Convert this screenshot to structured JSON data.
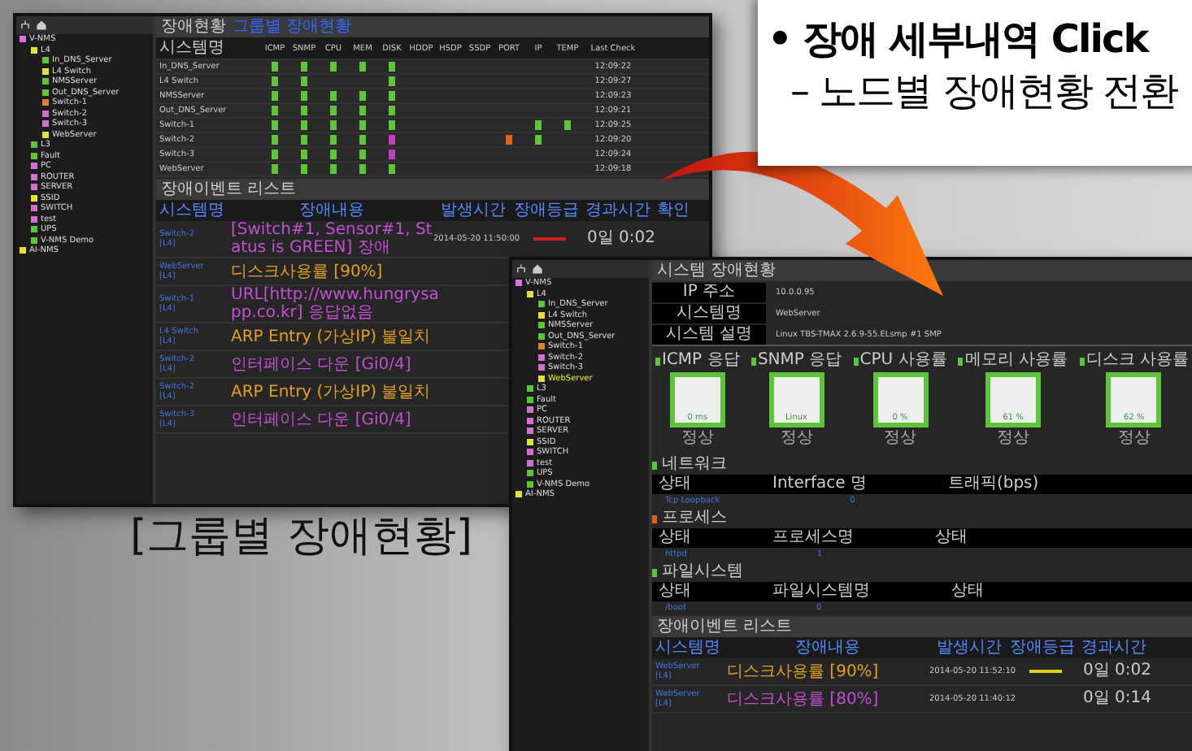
{
  "caption": {
    "title": "• 장애 세부내역 Click",
    "subtitle": "– 노드별 장애현황 전환"
  },
  "group_caption": "[그룹별 장애현황]",
  "group_window": {
    "tree": [
      {
        "label": "V-NMS",
        "color": "#e070e0",
        "selected": false,
        "children": [
          {
            "label": "L4",
            "color": "#e0e040",
            "selected": false,
            "children": [
              {
                "label": "In_DNS_Server",
                "color": "#5ec43a",
                "selected": false
              },
              {
                "label": "L4 Switch",
                "color": "#e0e040",
                "selected": false
              },
              {
                "label": "NMSServer",
                "color": "#5ec43a",
                "selected": false
              },
              {
                "label": "Out_DNS_Server",
                "color": "#5ec43a",
                "selected": false
              },
              {
                "label": "Switch-1",
                "color": "#e08030",
                "selected": false
              },
              {
                "label": "Switch-2",
                "color": "#d070d0",
                "selected": false
              },
              {
                "label": "Switch-3",
                "color": "#d070d0",
                "selected": false
              },
              {
                "label": "WebServer",
                "color": "#e0e040",
                "selected": false
              }
            ]
          },
          {
            "label": "L3",
            "color": "#5ec43a",
            "selected": false
          },
          {
            "label": "Fault",
            "color": "#5ec43a",
            "selected": false
          },
          {
            "label": "PC",
            "color": "#d070d0",
            "selected": false
          },
          {
            "label": "ROUTER",
            "color": "#d070d0",
            "selected": false
          },
          {
            "label": "SERVER",
            "color": "#d070d0",
            "selected": false
          },
          {
            "label": "SSID",
            "color": "#e0e040",
            "selected": false
          },
          {
            "label": "SWITCH",
            "color": "#d070d0",
            "selected": false
          },
          {
            "label": "test",
            "color": "#d070d0",
            "selected": false
          },
          {
            "label": "UPS",
            "color": "#5ec43a",
            "selected": false
          },
          {
            "label": "V-NMS Demo",
            "color": "#5ec43a",
            "selected": false
          }
        ]
      },
      {
        "label": "AI-NMS",
        "color": "#e0e040",
        "selected": false
      }
    ],
    "status_title": "장애현황",
    "status_link": "그룹별 장애현황",
    "columns": [
      "시스템명",
      "ICMP",
      "SNMP",
      "CPU",
      "MEM",
      "DISK",
      "HDDP",
      "HSDP",
      "SSDP",
      "PORT",
      "IP",
      "TEMP",
      "Last Check"
    ],
    "rows": [
      {
        "name": "In_DNS_Server",
        "cells": [
          {
            "color": "#5ec43a"
          },
          {
            "color": "#5ec43a"
          },
          {
            "color": "#5ec43a"
          },
          {
            "color": "#5ec43a"
          },
          {
            "color": "#5ec43a"
          },
          null,
          null,
          null,
          null,
          null,
          null
        ],
        "last_check": "12:09:22"
      },
      {
        "name": "L4 Switch",
        "cells": [
          {
            "color": "#5ec43a"
          },
          {
            "color": "#5ec43a"
          },
          null,
          null,
          {
            "color": "#5ec43a"
          },
          null,
          null,
          null,
          null,
          null,
          null
        ],
        "last_check": "12:09:27"
      },
      {
        "name": "NMSServer",
        "cells": [
          {
            "color": "#5ec43a"
          },
          {
            "color": "#5ec43a"
          },
          {
            "color": "#5ec43a"
          },
          {
            "color": "#5ec43a"
          },
          {
            "color": "#5ec43a"
          },
          null,
          null,
          null,
          null,
          null,
          null
        ],
        "last_check": "12:09:23"
      },
      {
        "name": "Out_DNS_Server",
        "cells": [
          {
            "color": "#5ec43a"
          },
          {
            "color": "#5ec43a"
          },
          {
            "color": "#5ec43a"
          },
          {
            "color": "#5ec43a"
          },
          {
            "color": "#5ec43a"
          },
          null,
          null,
          null,
          null,
          null,
          null
        ],
        "last_check": "12:09:21"
      },
      {
        "name": "Switch-1",
        "cells": [
          {
            "color": "#5ec43a"
          },
          {
            "color": "#5ec43a"
          },
          {
            "color": "#5ec43a"
          },
          {
            "color": "#5ec43a"
          },
          {
            "color": "#5ec43a"
          },
          null,
          null,
          null,
          null,
          {
            "color": "#5ec43a"
          },
          {
            "color": "#5ec43a"
          }
        ],
        "last_check": "12:09:25"
      },
      {
        "name": "Switch-2",
        "cells": [
          {
            "color": "#5ec43a"
          },
          {
            "color": "#5ec43a"
          },
          {
            "color": "#5ec43a"
          },
          {
            "color": "#5ec43a"
          },
          {
            "color": "#c040c0"
          },
          null,
          null,
          null,
          {
            "color": "#e06020"
          },
          {
            "color": "#5ec43a"
          },
          null
        ],
        "last_check": "12:09:20"
      },
      {
        "name": "Switch-3",
        "cells": [
          {
            "color": "#5ec43a"
          },
          {
            "color": "#5ec43a"
          },
          {
            "color": "#5ec43a"
          },
          {
            "color": "#5ec43a"
          },
          {
            "color": "#c040c0"
          },
          null,
          null,
          null,
          null,
          null,
          null
        ],
        "last_check": "12:09:24"
      },
      {
        "name": "WebServer",
        "cells": [
          {
            "color": "#5ec43a"
          },
          {
            "color": "#5ec43a"
          },
          {
            "color": "#5ec43a"
          },
          {
            "color": "#5ec43a"
          },
          {
            "color": "#5ec43a"
          },
          null,
          null,
          null,
          null,
          null,
          null
        ],
        "last_check": "12:09:18"
      }
    ],
    "events": {
      "title": "장애이벤트 리스트",
      "columns": [
        "시스템명",
        "장애내용",
        "발생시간",
        "장애등급",
        "경과시간",
        "확인"
      ],
      "rows": [
        {
          "node": "Switch-2",
          "group": "[L4]",
          "message": "[Switch#1, Sensor#1, Status is GREEN] 장애",
          "color": "#c050d0",
          "time": "2014-05-20 11:50:00",
          "grade": {
            "color": "#d02020"
          },
          "elapsed": "0일 0:02"
        },
        {
          "node": "WebServer",
          "group": "[L4]",
          "message": "디스크사용률 [90%]",
          "color": "#e0a020"
        },
        {
          "node": "Switch-1",
          "group": "[L4]",
          "message": "URL[http://www.hungrysapp.co.kr] 응답없음",
          "color": "#c050d0"
        },
        {
          "node": "L4 Switch",
          "group": "[L4]",
          "message": "ARP Entry (가상IP) 불일치",
          "color": "#e0a020"
        },
        {
          "node": "Switch-2",
          "group": "[L4]",
          "message": "인터페이스 다운 [Gi0/4]",
          "color": "#c050d0"
        },
        {
          "node": "Switch-2",
          "group": "[L4]",
          "message": "ARP Entry (가상IP) 불일치",
          "color": "#e0a020"
        },
        {
          "node": "Switch-3",
          "group": "[L4]",
          "message": "인터페이스 다운 [Gi0/4]",
          "color": "#c050d0"
        }
      ]
    }
  },
  "node_window": {
    "tree": [
      {
        "label": "V-NMS",
        "color": "#e070e0",
        "selected": false,
        "children": [
          {
            "label": "L4",
            "color": "#e0e040",
            "selected": false,
            "children": [
              {
                "label": "In_DNS_Server",
                "color": "#5ec43a",
                "selected": false
              },
              {
                "label": "L4 Switch",
                "color": "#e0e040",
                "selected": false
              },
              {
                "label": "NMSServer",
                "color": "#5ec43a",
                "selected": false
              },
              {
                "label": "Out_DNS_Server",
                "color": "#5ec43a",
                "selected": false
              },
              {
                "label": "Switch-1",
                "color": "#e08030",
                "selected": false
              },
              {
                "label": "Switch-2",
                "color": "#d070d0",
                "selected": false
              },
              {
                "label": "Switch-3",
                "color": "#d070d0",
                "selected": false
              },
              {
                "label": "WebServer",
                "color": "#e0e040",
                "selected": true
              }
            ]
          },
          {
            "label": "L3",
            "color": "#5ec43a",
            "selected": false
          },
          {
            "label": "Fault",
            "color": "#5ec43a",
            "selected": false
          },
          {
            "label": "PC",
            "color": "#d070d0",
            "selected": false
          },
          {
            "label": "ROUTER",
            "color": "#d070d0",
            "selected": false
          },
          {
            "label": "SERVER",
            "color": "#d070d0",
            "selected": false
          },
          {
            "label": "SSID",
            "color": "#e0e040",
            "selected": false
          },
          {
            "label": "SWITCH",
            "color": "#d070d0",
            "selected": false
          },
          {
            "label": "test",
            "color": "#d070d0",
            "selected": false
          },
          {
            "label": "UPS",
            "color": "#5ec43a",
            "selected": false
          },
          {
            "label": "V-NMS Demo",
            "color": "#5ec43a",
            "selected": false
          }
        ]
      },
      {
        "label": "AI-NMS",
        "color": "#e0e040",
        "selected": false
      }
    ],
    "title": "시스템 장애현황",
    "info": [
      {
        "label": "IP 주소",
        "value": "10.0.0.95"
      },
      {
        "label": "시스템명",
        "value": "WebServer"
      },
      {
        "label": "시스템 설명",
        "value": "Linux TBS-TMAX 2.6.9-55.ELsmp #1 SMP"
      }
    ],
    "monitors": [
      {
        "label": "ICMP 응답",
        "value": "0 ms",
        "status": "정상",
        "color": "#5ec43a"
      },
      {
        "label": "SNMP 응답",
        "value": "Linux",
        "status": "정상",
        "color": "#5ec43a"
      },
      {
        "label": "CPU 사용률",
        "value": "0 %",
        "status": "정상",
        "color": "#5ec43a"
      },
      {
        "label": "메모리 사용률",
        "value": "61 %",
        "status": "정상",
        "color": "#5ec43a"
      },
      {
        "label": "디스크 사용률",
        "value": "62 %",
        "status": "정상",
        "color": "#5ec43a"
      }
    ],
    "sections": [
      {
        "title": "네트워크",
        "color": "#5ec43a",
        "columns": [
          "상태",
          "Interface 명",
          "트래픽(bps)"
        ],
        "rows": [
          {
            "name": "Tcp Loopback",
            "value": "0"
          }
        ]
      },
      {
        "title": "프로세스",
        "color": "#e06020",
        "columns": [
          "상태",
          "프로세스명",
          "상태"
        ],
        "rows": [
          {
            "name": "httpd",
            "value": "1"
          }
        ]
      },
      {
        "title": "파일시스템",
        "color": "#5ec43a",
        "columns": [
          "상태",
          "파일시스템명",
          "상태"
        ],
        "rows": [
          {
            "name": "/boot",
            "value": "0"
          }
        ]
      }
    ],
    "events": {
      "title": "장애이벤트 리스트",
      "columns": [
        "시스템명",
        "장애내용",
        "발생시간",
        "장애등급",
        "경과시간"
      ],
      "rows": [
        {
          "node": "WebServer",
          "group": "[L4]",
          "message": "디스크사용률 [90%]",
          "color": "#e0a020",
          "time": "2014-05-20 11:52:10",
          "grade": {
            "color": "#e0d020"
          },
          "elapsed": "0일 0:02"
        },
        {
          "node": "WebServer",
          "group": "[L4]",
          "message": "디스크사용률 [80%]",
          "color": "#c050d0",
          "time": "2014-05-20 11:40:12",
          "elapsed": "0일 0:14"
        }
      ]
    }
  }
}
